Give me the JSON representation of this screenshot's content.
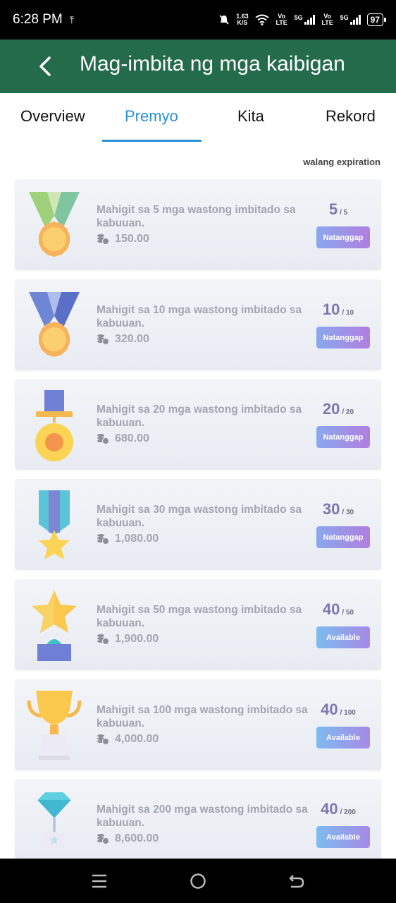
{
  "status_bar": {
    "time": "6:28 PM",
    "speed_value": "1.63",
    "speed_unit": "K/S",
    "volte1": "Vo LTE",
    "net1": "5G",
    "volte2": "Vo LTE",
    "net2": "5G",
    "battery": "97"
  },
  "header": {
    "title": "Mag-imbita ng mga kaibigan"
  },
  "tabs": [
    {
      "label": "Overview"
    },
    {
      "label": "Premyo"
    },
    {
      "label": "Kita"
    },
    {
      "label": "Rekord"
    }
  ],
  "active_tab": "Premyo",
  "expiry_note": "walang expiration",
  "rewards": [
    {
      "desc": "Mahigit sa 5 mga wastong imbitado sa kabuuan.",
      "amount": "150.00",
      "current": "5",
      "total": "/ 5",
      "button": "Natanggap",
      "medal": "green-medal-icon"
    },
    {
      "desc": "Mahigit sa 10 mga wastong imbitado sa kabuuan.",
      "amount": "320.00",
      "current": "10",
      "total": "/ 10",
      "button": "Natanggap",
      "medal": "blue-medal-icon"
    },
    {
      "desc": "Mahigit sa 20 mga wastong imbitado sa kabuuan.",
      "amount": "680.00",
      "current": "20",
      "total": "/ 20",
      "button": "Natanggap",
      "medal": "gold-medal-icon"
    },
    {
      "desc": "Mahigit sa 30 mga wastong imbitado sa kabuuan.",
      "amount": "1,080.00",
      "current": "30",
      "total": "/ 30",
      "button": "Natanggap",
      "medal": "star-ribbon-medal-icon"
    },
    {
      "desc": "Mahigit sa 50 mga wastong imbitado sa kabuuan.",
      "amount": "1,900.00",
      "current": "40",
      "total": "/ 50",
      "button": "Available",
      "medal": "star-trophy-icon"
    },
    {
      "desc": "Mahigit sa 100 mga wastong imbitado sa kabuuan.",
      "amount": "4,000.00",
      "current": "40",
      "total": "/ 100",
      "button": "Available",
      "medal": "gold-cup-icon"
    },
    {
      "desc": "Mahigit sa 200 mga wastong imbitado sa kabuuan.",
      "amount": "8,600.00",
      "current": "40",
      "total": "/ 200",
      "button": "Available",
      "medal": "diamond-trophy-icon"
    }
  ],
  "colors": {
    "header_bg": "#246b4c",
    "accent": "#2a8fd8",
    "progress_text": "#7b78b0"
  }
}
